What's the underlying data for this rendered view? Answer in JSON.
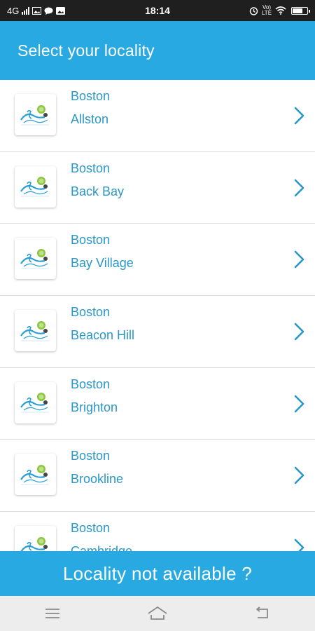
{
  "status_bar": {
    "network": "4G",
    "time": "18:14",
    "volte": "Vo) LTE"
  },
  "header": {
    "title": "Select your locality"
  },
  "list": {
    "items": [
      {
        "city": "Boston",
        "locality": "Allston"
      },
      {
        "city": "Boston",
        "locality": "Back Bay"
      },
      {
        "city": "Boston",
        "locality": "Bay Village"
      },
      {
        "city": "Boston",
        "locality": "Beacon Hill"
      },
      {
        "city": "Boston",
        "locality": "Brighton"
      },
      {
        "city": "Boston",
        "locality": "Brookline"
      },
      {
        "city": "Boston",
        "locality": "Cambridge"
      }
    ]
  },
  "footer": {
    "banner_text": "Locality not available ?"
  },
  "colors": {
    "primary": "#29a9e1",
    "text_blue": "#2a97c6",
    "divider": "#dcdcdc"
  },
  "icons": {
    "list_thumb": "logo-thumbnail",
    "list_arrow": "chevron-right-icon",
    "nav": [
      "menu-icon",
      "home-icon",
      "back-icon"
    ]
  }
}
